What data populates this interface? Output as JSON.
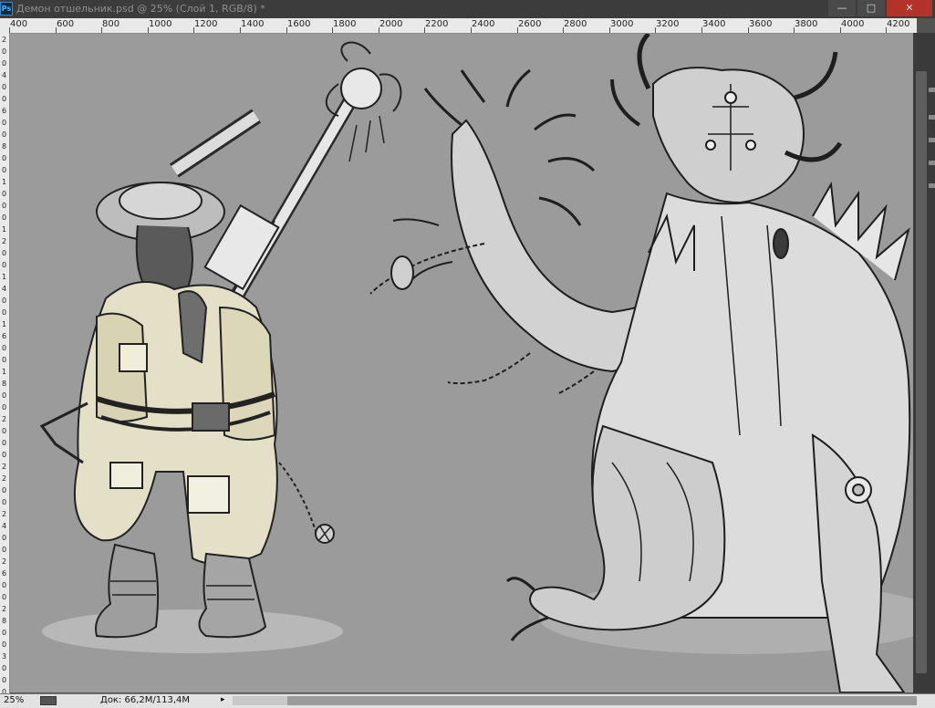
{
  "window": {
    "app_icon": "Ps",
    "title": "Демон отшельник.psd @ 25% (Слой 1, RGB/8) *",
    "controls": {
      "minimize": "—",
      "maximize": "□",
      "close": "✕"
    }
  },
  "ruler_h": [
    "400",
    "600",
    "800",
    "1000",
    "1200",
    "1400",
    "1600",
    "1800",
    "2000",
    "2200",
    "2400",
    "2600",
    "2800",
    "3000",
    "3200",
    "3400",
    "3600",
    "3800",
    "4000",
    "4200"
  ],
  "ruler_v": [
    "2",
    "0",
    "0",
    "4",
    "0",
    "0",
    "6",
    "0",
    "0",
    "8",
    "0",
    "0",
    "1",
    "0",
    "0",
    "0",
    "1",
    "2",
    "0",
    "0",
    "1",
    "4",
    "0",
    "0",
    "1",
    "6",
    "0",
    "0",
    "1",
    "8",
    "0",
    "0",
    "2",
    "0",
    "0",
    "0",
    "2",
    "2",
    "0",
    "0",
    "2",
    "4",
    "0",
    "0",
    "2",
    "6",
    "0",
    "0",
    "2",
    "8",
    "0",
    "0",
    "3",
    "0",
    "0",
    "0"
  ],
  "status": {
    "zoom": "25%",
    "doc_size": "Док: 66,2M/113,4M",
    "arrow": "▸"
  },
  "canvas": {
    "background": "#9b9b9b",
    "artwork": "sketch of a hermit warrior and a large demon"
  },
  "icons": {
    "app": "photoshop-icon",
    "zoom_nav": "navigator-icon"
  }
}
